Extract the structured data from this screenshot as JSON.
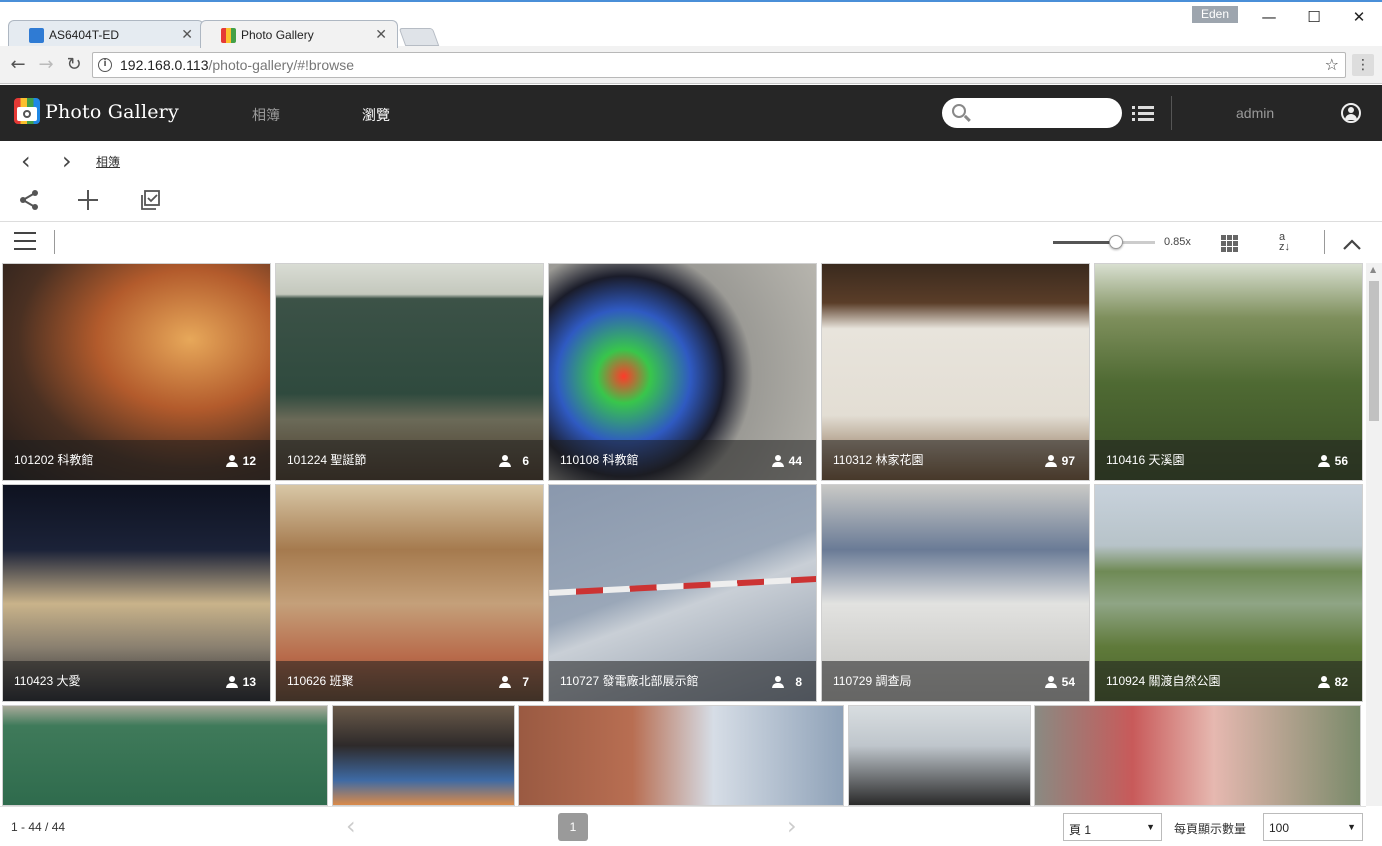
{
  "browser": {
    "tabs": [
      {
        "label": "AS6404T-ED",
        "active": false,
        "icon": "asustor-icon"
      },
      {
        "label": "Photo Gallery",
        "active": true,
        "icon": "photo-gallery-icon"
      }
    ],
    "profile_name": "Eden",
    "url_host": "192.168.0.113",
    "url_path": "/photo-gallery/#!browse"
  },
  "app": {
    "title": "Photo Gallery",
    "nav": [
      {
        "label": "相簿",
        "active": false
      },
      {
        "label": "瀏覽",
        "active": true
      }
    ],
    "search_placeholder": "",
    "username": "admin"
  },
  "breadcrumb": {
    "label": "相簿"
  },
  "view": {
    "zoom_label": "0.85x",
    "zoom_level": 0.62
  },
  "albums": [
    {
      "title": "101202 科教館",
      "count": "12",
      "date": ""
    },
    {
      "title": "101224 聖誕節",
      "count": "6",
      "date": ""
    },
    {
      "title": "110108 科教館",
      "count": "44",
      "date": ""
    },
    {
      "title": "110312 林家花園",
      "count": "97",
      "date": ""
    },
    {
      "title": "110416 天溪園",
      "count": "56",
      "date": ""
    },
    {
      "title": "110423 大愛",
      "count": "13",
      "date": ""
    },
    {
      "title": "110626 班聚",
      "count": "7",
      "date": ""
    },
    {
      "title": "110727 發電廠北部展示館",
      "count": "8",
      "date": ""
    },
    {
      "title": "110729 調查局",
      "count": "54",
      "date": ""
    },
    {
      "title": "110924 關渡自然公園",
      "count": "82",
      "date": ""
    }
  ],
  "pagination": {
    "range": "1 - 44 / 44",
    "current_page": "1",
    "page_select": "頁 1",
    "per_page_label": "每頁顯示數量",
    "per_page_value": "100"
  },
  "colors": {
    "appbar": "#262626",
    "nav_inactive": "#9a9a9a",
    "nav_active": "#ffffff",
    "date_stamp": "#c0392b"
  }
}
